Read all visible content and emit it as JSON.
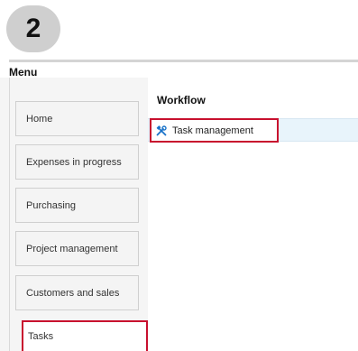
{
  "step": {
    "number": "2"
  },
  "menu": {
    "title": "Menu"
  },
  "sidebar": {
    "items": [
      {
        "label": "Home"
      },
      {
        "label": "Expenses in progress"
      },
      {
        "label": "Purchasing"
      },
      {
        "label": "Project management"
      },
      {
        "label": "Customers and sales"
      },
      {
        "label": "Tasks"
      }
    ],
    "active_item": "Tasks"
  },
  "workflow": {
    "title": "Workflow",
    "items": [
      {
        "label": "Task management",
        "icon": "tools-icon"
      }
    ]
  },
  "colors": {
    "highlight": "#c8102e",
    "row_band": "#e8f4fb",
    "icon": "#1a73c9"
  }
}
